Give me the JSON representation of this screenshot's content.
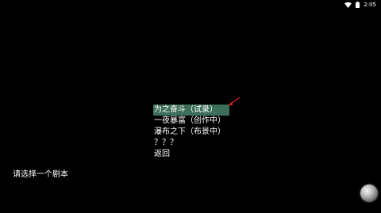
{
  "status_bar": {
    "time": "2:05",
    "icons": [
      "wifi-icon",
      "battery-icon"
    ]
  },
  "menu": {
    "items": [
      {
        "label": "为之奋斗（试录）",
        "selected": true
      },
      {
        "label": "一夜暴富（创作中）",
        "selected": false
      },
      {
        "label": "瀑布之下（布景中）",
        "selected": false
      },
      {
        "label": "？？？",
        "selected": false
      },
      {
        "label": "返回",
        "selected": false
      }
    ]
  },
  "prompt": "请选择一个剧本",
  "colors": {
    "background": "#000000",
    "selection": "#3d6e5a",
    "cursor": "#cc2222",
    "text": "#ffffff"
  },
  "icons": {
    "cursor": "red-arrow-cursor-icon",
    "joystick": "joystick-button-icon"
  }
}
